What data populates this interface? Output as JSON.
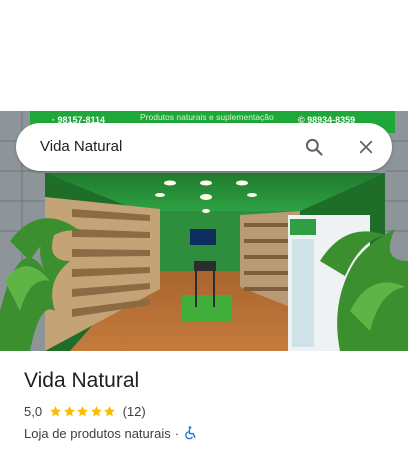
{
  "search": {
    "query": "Vida Natural"
  },
  "storefront": {
    "sign_phone_left": "· 98157-8114",
    "sign_text": "Produtos naturais e suplementação",
    "sign_phone_right": "© 98934-8359"
  },
  "place": {
    "name": "Vida Natural",
    "rating": "5,0",
    "stars": 5,
    "reviews": "(12)",
    "category": "Loja de produtos naturais",
    "separator": "·"
  },
  "colors": {
    "star": "#fbbc04",
    "accessibility": "#1a73e8",
    "store_green": "#1fa83a"
  },
  "icons": {
    "search": "search-icon",
    "close": "close-icon",
    "accessibility": "wheelchair-icon"
  }
}
